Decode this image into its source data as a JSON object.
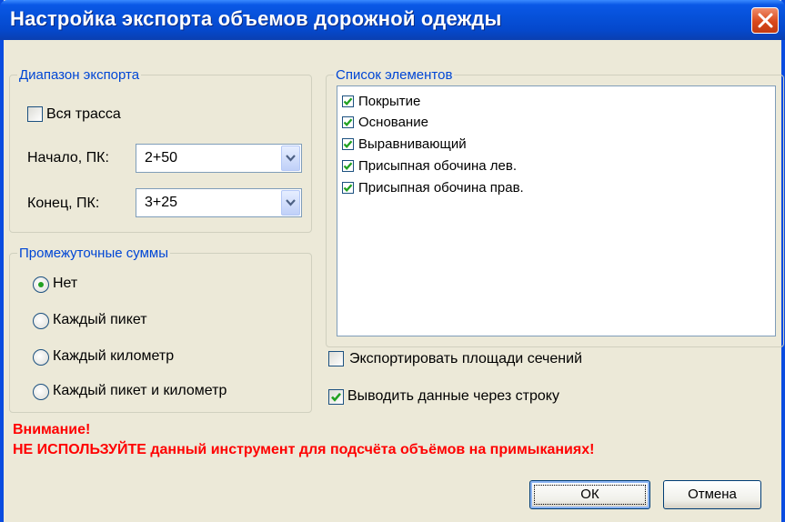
{
  "window": {
    "title": "Настройка экспорта объемов дорожной одежды",
    "title_color": "#ffffff",
    "titlebar_color": "#0650d8",
    "close_icon": "close-icon"
  },
  "export_range": {
    "legend": "Диапазон экспорта",
    "whole_route": {
      "label": "Вся трасса",
      "checked": false
    },
    "start": {
      "label": "Начало, ПК:",
      "value": "2+50"
    },
    "end": {
      "label": "Конец, ПК:",
      "value": "3+25"
    }
  },
  "subtotals": {
    "legend": "Промежуточные суммы",
    "selected_index": 0,
    "options": [
      {
        "label": "Нет"
      },
      {
        "label": "Каждый пикет"
      },
      {
        "label": "Каждый километр"
      },
      {
        "label": "Каждый пикет и километр"
      }
    ]
  },
  "elements": {
    "legend": "Список элементов",
    "items": [
      {
        "label": "Покрытие",
        "checked": true
      },
      {
        "label": "Основание",
        "checked": true
      },
      {
        "label": "Выравнивающий",
        "checked": true
      },
      {
        "label": "Присыпная обочина лев.",
        "checked": true
      },
      {
        "label": "Присыпная обочина прав.",
        "checked": true
      }
    ]
  },
  "options": {
    "export_sections": {
      "label": "Экспортировать площади сечений",
      "checked": false
    },
    "output_every_other": {
      "label": "Выводить данные через строку",
      "checked": true
    }
  },
  "warning": {
    "line1": "Внимание!",
    "line2": "НЕ ИСПОЛЬЗУЙТЕ данный инструмент для подсчёта объёмов на примыканиях!",
    "color": "#ff0000"
  },
  "buttons": {
    "ok": "ОК",
    "cancel": "Отмена"
  },
  "colors": {
    "dialog_bg": "#ece9d8",
    "legend": "#0046d5",
    "check": "#21a121"
  }
}
